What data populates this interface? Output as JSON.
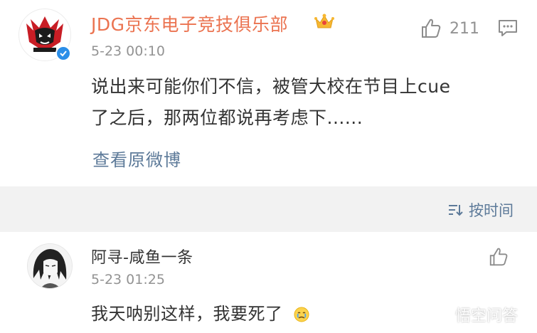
{
  "post": {
    "author": "JDG京东电子竞技俱乐部",
    "time": "5-23 00:10",
    "likes": "211",
    "content_line1": "说出来可能你们不信，被管大校在节目上cue",
    "content_line2": "了之后，那两位都说再考虑下......",
    "view_original": "查看原微博"
  },
  "sort": {
    "label": "按时间"
  },
  "comment": {
    "name": "阿寻-咸鱼一条",
    "time": "5-23 01:25",
    "text": "我天呐别这样，我要死了"
  },
  "watermark": {
    "text": "悟空问答"
  },
  "colors": {
    "author": "#eb7350",
    "link": "#5d7a99",
    "meta": "#939393",
    "verified": "#2b8ee8",
    "divider_bg": "#f2f2f2"
  },
  "icons": [
    "crown-icon",
    "verified-icon",
    "thumbs-up-icon",
    "comment-icon",
    "sort-icon",
    "crying-emoji",
    "wukong-logo-icon"
  ]
}
